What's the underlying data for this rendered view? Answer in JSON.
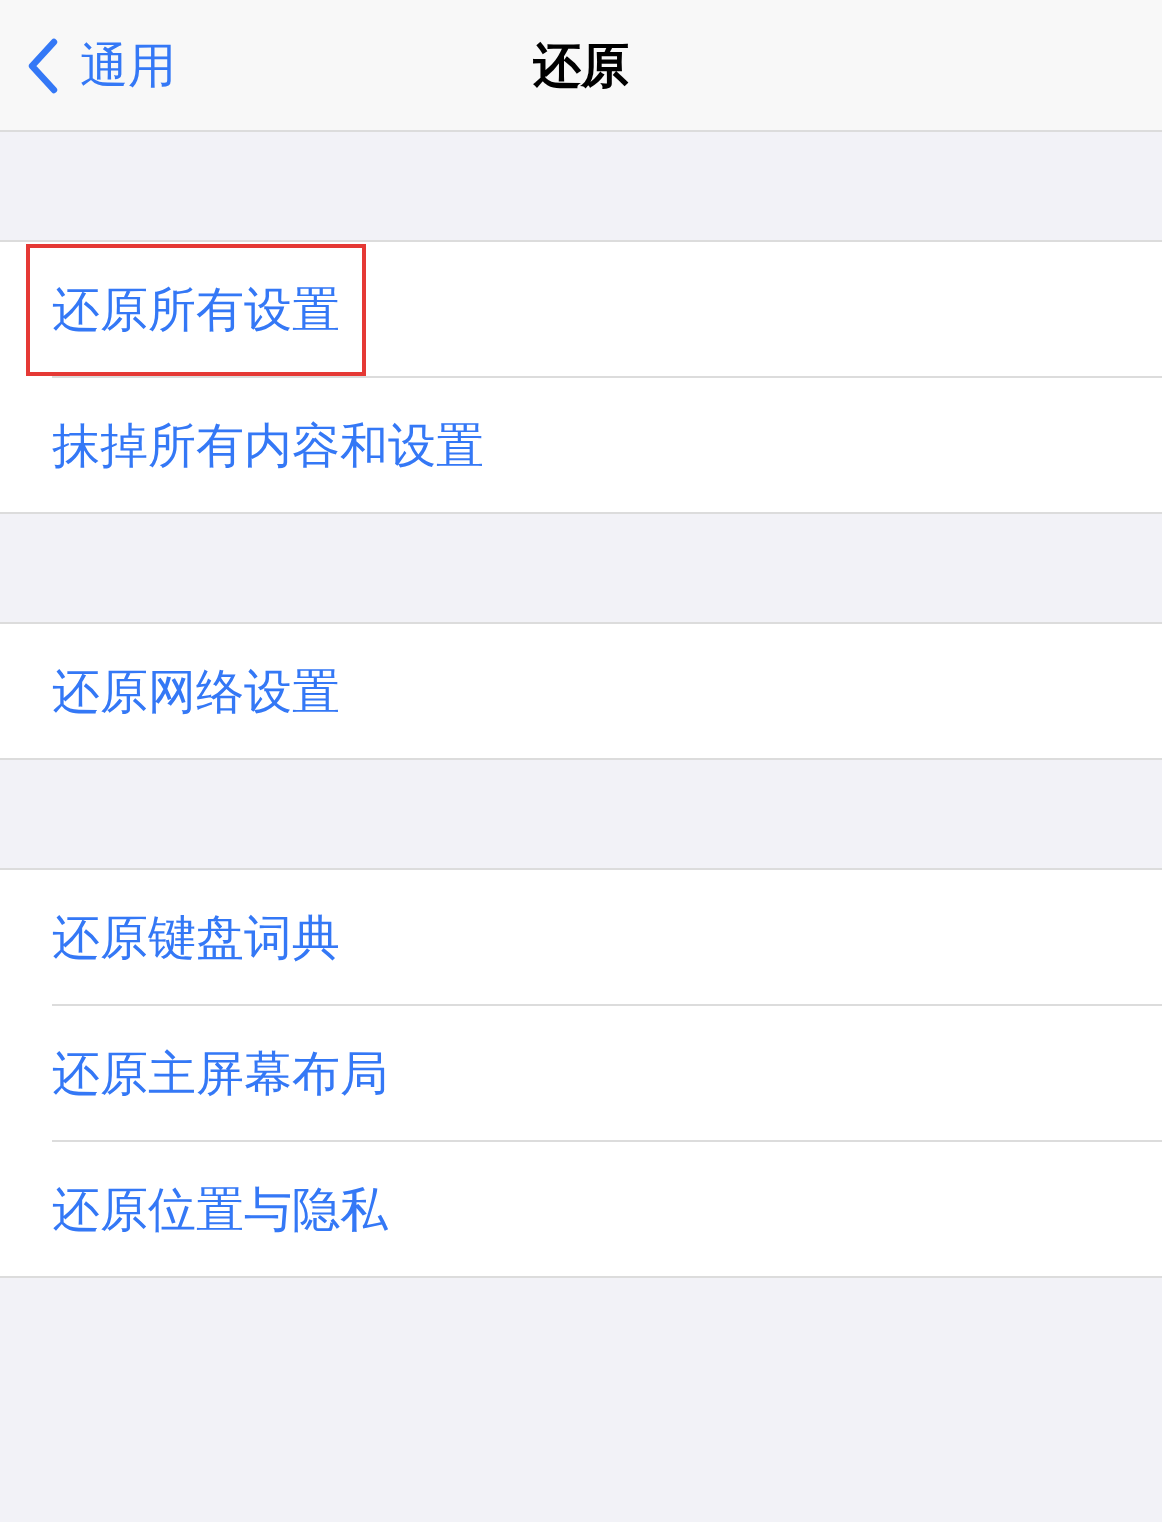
{
  "nav": {
    "back_label": "通用",
    "title": "还原"
  },
  "groups": [
    {
      "items": [
        {
          "label": "还原所有设置",
          "highlighted": true
        },
        {
          "label": "抹掉所有内容和设置",
          "highlighted": false
        }
      ]
    },
    {
      "items": [
        {
          "label": "还原网络设置",
          "highlighted": false
        }
      ]
    },
    {
      "items": [
        {
          "label": "还原键盘词典",
          "highlighted": false
        },
        {
          "label": "还原主屏幕布局",
          "highlighted": false
        },
        {
          "label": "还原位置与隐私",
          "highlighted": false
        }
      ]
    }
  ]
}
